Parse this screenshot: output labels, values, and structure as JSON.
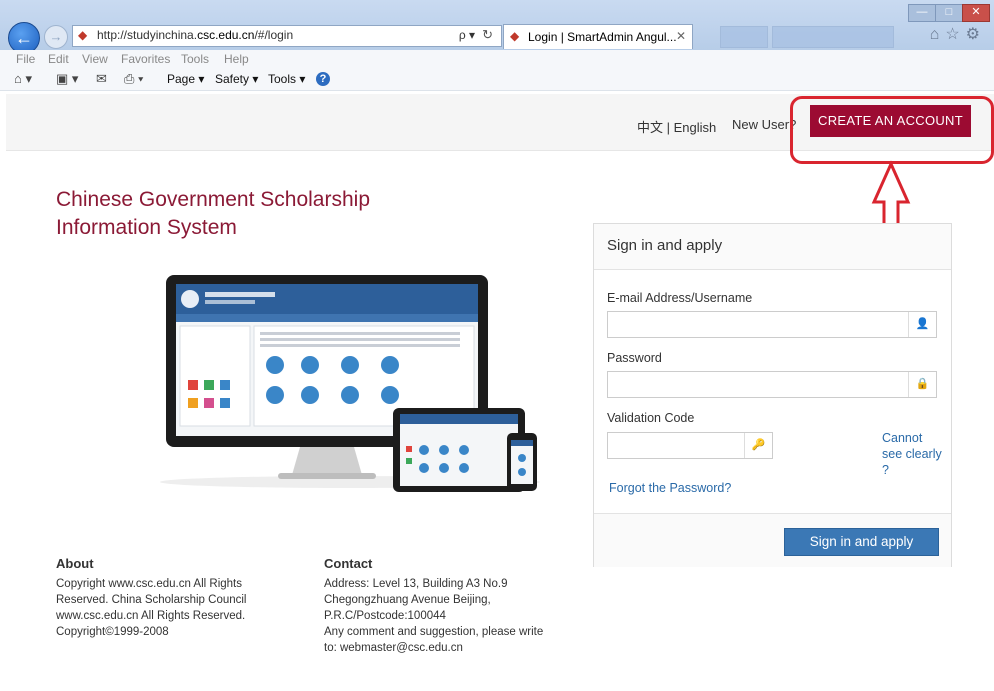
{
  "browser": {
    "url_prefix": "http://studyinchina.",
    "url_domain": "csc.edu.cn",
    "url_suffix": "/#/login",
    "search_symbol": "ρ ▾",
    "refresh_symbol": "↻",
    "tab_title": "Login | SmartAdmin Angul...",
    "tab_close": "✕",
    "menu": [
      "File",
      "Edit",
      "View",
      "Favorites",
      "Tools",
      "Help"
    ],
    "commands": {
      "page": "Page ▾",
      "safety": "Safety ▾",
      "tools": "Tools ▾",
      "help": "?"
    },
    "window_controls": {
      "minimize": "—",
      "maximize": "□",
      "close": "✕"
    }
  },
  "header": {
    "language": "中文 | English",
    "new_user": "New User?",
    "create_account": "CREATE AN ACCOUNT"
  },
  "site_title_line1": "Chinese Government Scholarship",
  "site_title_line2": "Information System",
  "login": {
    "heading": "Sign in and apply",
    "email_label": "E-mail Address/Username",
    "email_value": "",
    "password_label": "Password",
    "password_value": "",
    "validation_label": "Validation Code",
    "validation_value": "",
    "cannot_see": "Cannot see clearly ?",
    "forgot": "Forgot the Password?",
    "submit": "Sign in and apply"
  },
  "footer": {
    "about_title": "About",
    "about_lines": [
      "Copyright www.csc.edu.cn All Rights",
      "Reserved. China Scholarship Council",
      "www.csc.edu.cn All Rights Reserved.",
      "Copyright©1999-2008"
    ],
    "contact_title": "Contact",
    "contact_lines": [
      "Address: Level 13, Building A3 No.9",
      "Chegongzhuang Avenue Beijing,",
      "P.R.C/Postcode:100044",
      "Any comment and suggestion, please write",
      "to: webmaster@csc.edu.cn"
    ]
  },
  "colors": {
    "brand": "#9c0b32",
    "link": "#2a6aa8",
    "button": "#3b78b5",
    "highlight": "#d9252f"
  }
}
